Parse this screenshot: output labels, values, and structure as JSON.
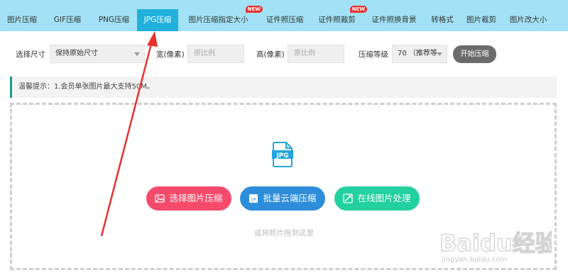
{
  "tabs": [
    {
      "label": "图片压缩",
      "active": false,
      "new": false
    },
    {
      "label": "GIF压缩",
      "active": false,
      "new": false
    },
    {
      "label": "PNG压缩",
      "active": false,
      "new": false
    },
    {
      "label": "JPG压缩",
      "active": true,
      "new": false
    },
    {
      "label": "图片压缩指定大小",
      "active": false,
      "new": true
    },
    {
      "label": "证件照压缩",
      "active": false,
      "new": false
    },
    {
      "label": "证件照裁剪",
      "active": false,
      "new": true
    },
    {
      "label": "证件照换背景",
      "active": false,
      "new": false
    },
    {
      "label": "转格式",
      "active": false,
      "new": false
    },
    {
      "label": "图片裁剪",
      "active": false,
      "new": false
    },
    {
      "label": "图片改大小",
      "active": false,
      "new": false
    }
  ],
  "new_badge": "NEW",
  "options": {
    "size_label": "选择尺寸",
    "size_value": "保持原始尺寸",
    "width_label": "宽(像素)",
    "width_placeholder": "原比例",
    "height_label": "高(像素)",
    "height_placeholder": "原比例",
    "level_label": "压缩等级",
    "level_value": "70 （推荐等",
    "start_button": "开始压缩"
  },
  "notice": "温馨提示：1.会员单张图片最大支持50M。",
  "dropzone": {
    "icon_text": "JPG",
    "buttons": {
      "select": "选择图片压缩",
      "batch": "批量云端压缩",
      "online": "在线图片处理"
    },
    "hint": "或将照片拖到这里"
  },
  "watermark": {
    "text": "Baidu经验",
    "url": "jingyan.baidu.com"
  },
  "colors": {
    "tabbar_bg": "#a3e2f6",
    "tab_active": "#22b0dc",
    "badge": "#e8312f",
    "btn_red": "#f54a6a",
    "btn_blue": "#2d8ddb",
    "btn_green": "#22d0a0",
    "notice_border": "#1a9b8c",
    "annotation_arrow": "#e8312f"
  }
}
